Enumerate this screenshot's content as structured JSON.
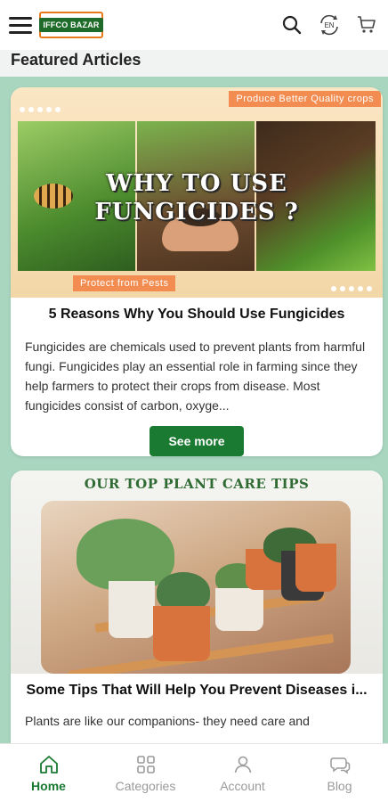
{
  "header": {
    "logo_text": "IFFCO BAZAR",
    "language_label": "EN"
  },
  "section_title": "Featured Articles",
  "articles": [
    {
      "image_title_line1": "WHY TO USE",
      "image_title_line2": "FUNGICIDES ?",
      "tag_top": "Produce Better Quality crops",
      "tag_bottom": "Protect from Pests",
      "title": "5 Reasons Why You Should Use Fungicides",
      "excerpt": "Fungicides are chemicals used to prevent plants from harmful fungi. Fungicides play an essential role in farming since they help farmers to protect their crops from disease. Most fungicides consist of carbon, oxyge...",
      "button_label": "See more"
    },
    {
      "image_banner": "OUR TOP PLANT CARE TIPS",
      "title": "Some Tips That Will Help You Prevent Diseases i...",
      "excerpt": "Plants are like our companions- they need care and"
    }
  ],
  "bottom_nav": [
    {
      "label": "Home",
      "icon": "home-icon",
      "active": true
    },
    {
      "label": "Categories",
      "icon": "categories-icon",
      "active": false
    },
    {
      "label": "Account",
      "icon": "account-icon",
      "active": false
    },
    {
      "label": "Blog",
      "icon": "blog-icon",
      "active": false
    }
  ],
  "colors": {
    "brand_green": "#1b7a32",
    "accent_orange": "#f28c50",
    "page_bg": "#a9d6bf"
  }
}
